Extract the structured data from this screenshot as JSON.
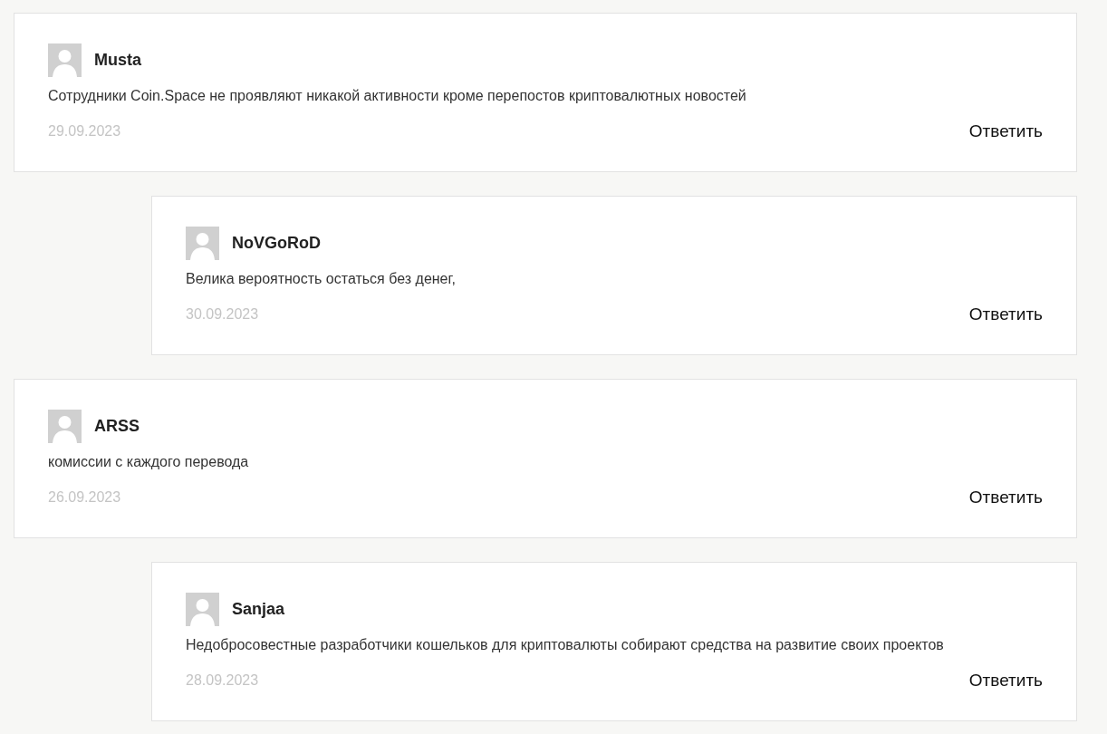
{
  "comments": [
    {
      "author": "Musta",
      "text": "Сотрудники Coin.Space не проявляют никакой активности кроме перепостов криптовалютных новостей",
      "date": "29.09.2023",
      "reply": "Ответить",
      "children": [
        {
          "author": "NoVGoRoD",
          "text": "Велика вероятность остаться без денег,",
          "date": "30.09.2023",
          "reply": "Ответить"
        }
      ]
    },
    {
      "author": "ARSS",
      "text": "комиссии с каждого перевода",
      "date": "26.09.2023",
      "reply": "Ответить",
      "children": [
        {
          "author": "Sanjaa",
          "text": "Недобросовестные разработчики кошельков для криптовалюты собирают средства на развитие своих проектов",
          "date": "28.09.2023",
          "reply": "Ответить"
        }
      ]
    }
  ]
}
